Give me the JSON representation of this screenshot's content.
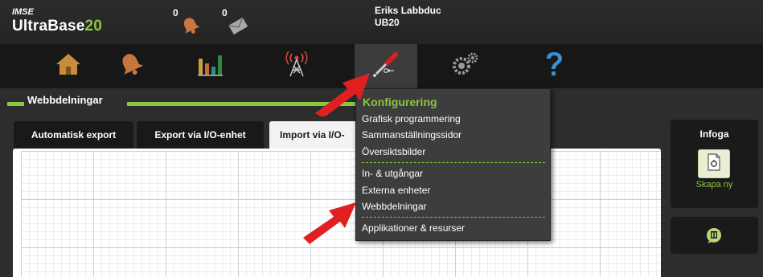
{
  "header": {
    "brand_sub": "IMSE",
    "brand_main": "UltraBase",
    "brand_num": "20",
    "alarm_count": "0",
    "message_count": "0",
    "user_name": "Eriks Labbduc",
    "user_site": "UB20"
  },
  "nav": {
    "items": [
      {
        "name": "home",
        "icon": "home-icon"
      },
      {
        "name": "alarms",
        "icon": "bell-icon"
      },
      {
        "name": "charts",
        "icon": "bar-chart-icon"
      },
      {
        "name": "communication",
        "icon": "antenna-icon"
      },
      {
        "name": "configuration",
        "icon": "screwdriver-icon",
        "active": true
      },
      {
        "name": "settings",
        "icon": "gears-icon"
      },
      {
        "name": "help",
        "icon": "question-icon"
      }
    ]
  },
  "section": {
    "title": "Webbdelningar"
  },
  "tabs": [
    {
      "label": "Automatisk export"
    },
    {
      "label": "Export via I/O-enhet"
    },
    {
      "label": "Import via I/O-"
    }
  ],
  "side_panel": {
    "title": "Infoga",
    "create_label": "Skapa ny"
  },
  "menu": {
    "heading": "Konfigurering",
    "group1": [
      "Grafisk programmering",
      "Sammanställningssidor",
      "Översiktsbilder"
    ],
    "group2": [
      "In- & utgångar",
      "Externa enheter",
      "Webbdelningar"
    ],
    "group3": [
      "Applikationer & resurser"
    ]
  },
  "colors": {
    "accent_green": "#8dc63f",
    "arrow_red": "#e02020",
    "nav_active_bg": "#3c3c3c"
  }
}
